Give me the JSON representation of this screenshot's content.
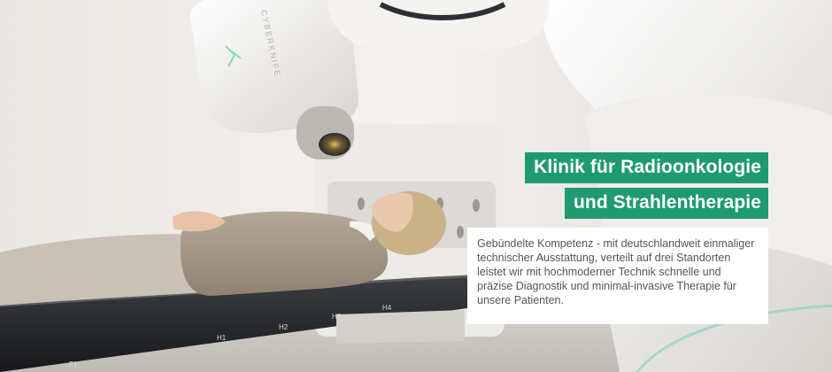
{
  "hero": {
    "title_line1": "Klinik für Radioonkologie",
    "title_line2": "und Strahlentherapie",
    "description": "Gebündelte Kompetenz - mit deutschlandweit einmaliger technischer Ausstattung, verteilt auf drei Standorten leistet wir mit  hochmoderner  Technik schnelle und präzise Diagnostik und minimal-invasive Therapie für unsere Patienten.",
    "accent_color": "#1f9a70",
    "table_labels": [
      "F1",
      "H1",
      "H2",
      "H3",
      "H4"
    ],
    "machine_label": "CYBERKNIFE"
  }
}
